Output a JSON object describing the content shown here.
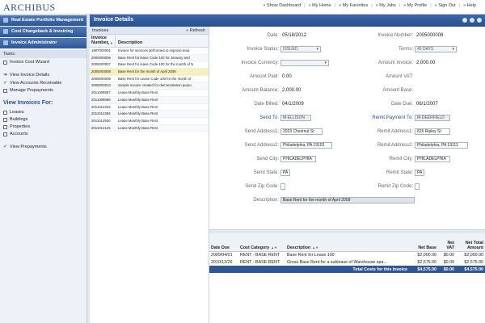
{
  "app": {
    "logo": "ARCHIBUS"
  },
  "topnav": [
    "» Show Dashboard",
    "» My Home",
    "» My Favorites",
    "» My Jobs",
    "» My Profile",
    "» Sign Out",
    "» Help"
  ],
  "sidebar": {
    "nav": [
      "Real Estate Portfolio Management",
      "Cost Chargeback & Invoicing",
      "Invoice Administrator"
    ],
    "tasks_label": "Tasks:",
    "tasks": [
      {
        "label": "Invoice Cost Wizard",
        "mark": "box"
      },
      {
        "label": "View Invoice Details",
        "mark": "arrow"
      },
      {
        "label": "View Accounts Receivable",
        "mark": "check"
      },
      {
        "label": "Manage Prepayments",
        "mark": "box"
      }
    ],
    "view_for_label": "View Invoices For:",
    "view_for": [
      "Leases",
      "Buildings",
      "Properties",
      "Accounts"
    ],
    "prepayments": "View Prepayments"
  },
  "main": {
    "title": "Invoice Details",
    "invoices": {
      "header": "Invoices",
      "refresh": "» Refresh",
      "col_number": "Invoice Number",
      "col_description": "Description",
      "rows": [
        {
          "num": "1997000001",
          "desc": "Invoice for services performed to improve tena"
        },
        {
          "num": "2000000006",
          "desc": "Base Rent for lease Code 100 for January and"
        },
        {
          "num": "2005000007",
          "desc": "Base Rent for lease Code 100 for the month of N"
        },
        {
          "num": "2005000008",
          "desc": "Base Rent for the month of April 2009"
        },
        {
          "num": "2005000009",
          "desc": "Base Rent for Lease Code 100 for the month of"
        },
        {
          "num": "2005000010",
          "desc": "sample invoice created for demonstration purpo"
        },
        {
          "num": "2011009987",
          "desc": "Lease Monthly Base Rent"
        },
        {
          "num": "2011009989",
          "desc": "Lease Monthly Base Rent"
        },
        {
          "num": "2011012333",
          "desc": "Lease Monthly Base Rent"
        },
        {
          "num": "2011012384",
          "desc": "Lease Monthly Base Rent"
        },
        {
          "num": "2011013930",
          "desc": "Lease Monthly Base Rent"
        },
        {
          "num": "2011014125",
          "desc": "Lease Monthly Base Rent"
        }
      ]
    },
    "detail": {
      "date_label": "Date:",
      "date": "05/18/2012",
      "invnum_label": "Invoice Number:",
      "invnum": "2005000008",
      "status_label": "Invoice Status:",
      "status": "ISSUED",
      "terms_label": "Terms:",
      "terms": "40 DAYS",
      "currency_label": "Invoice Currency:",
      "currency": "",
      "amount_inv_label": "Amount Invoice:",
      "amount_inv": "2,000.00",
      "amount_paid_label": "Amount Paid:",
      "amount_paid": "0.00",
      "amount_vat_label": "Amount VAT:",
      "amount_vat": "",
      "amount_bal_label": "Amount Balance:",
      "amount_bal": "2,000.00",
      "amount_base_label": "Amount Base:",
      "amount_base": "",
      "date_billed_label": "Date Billed:",
      "date_billed": "04/1/2009",
      "date_due_label": "Date Due:",
      "date_due": "06/1/2007",
      "send_to_label": "Send To:",
      "send_to": "M-ELLISON",
      "remit_to_label": "Remit Payment To:",
      "remit_to": "M-DEERFIELD",
      "send_addr1_label": "Send Address1:",
      "send_addr1": "2033 Chestnut St",
      "remit_addr1_label": "Remit Address1:",
      "remit_addr1": "815 Ripley St",
      "send_addr2_label": "Send Address2:",
      "send_addr2": "Philadelphia, PA 19103",
      "remit_addr2_label": "Remit Address2:",
      "remit_addr2": "Philadelphia, PA 19111",
      "send_city_label": "Send City:",
      "send_city": "PHILADELPHIA",
      "remit_city_label": "Remit City:",
      "remit_city": "PHILADELPHIA",
      "send_state_label": "Send State:",
      "send_state": "PA",
      "remit_state_label": "Remit State:",
      "remit_state": "PA",
      "send_zip_label": "Send Zip Code:",
      "send_zip": "",
      "remit_zip_label": "Remit Zip Code:",
      "remit_zip": "",
      "description_label": "Description:",
      "description": "Base Rent for the month of April 2009"
    },
    "costs": {
      "headers": [
        "Date Due",
        "Cost Category",
        "Description",
        "Net Base",
        "Net VAT",
        "Net Total Amount"
      ],
      "rows": [
        [
          "2009/04/01",
          "RENT - BASE RENT",
          "Base Rent for Lease 100",
          "$2,000.00",
          "$0.00",
          "$2,000.00"
        ],
        [
          "2010/12/26",
          "RENT - BASE RENT",
          "Gross Base Rent for a sublease of Warehouse spa...",
          "$2,575.00",
          "$0.00",
          "$2,575.00"
        ]
      ],
      "total_label": "Total Costs for this Invoice",
      "total_base": "$4,575.00",
      "total_vat": "$0.00",
      "total_amount": "$4,575.00"
    }
  }
}
